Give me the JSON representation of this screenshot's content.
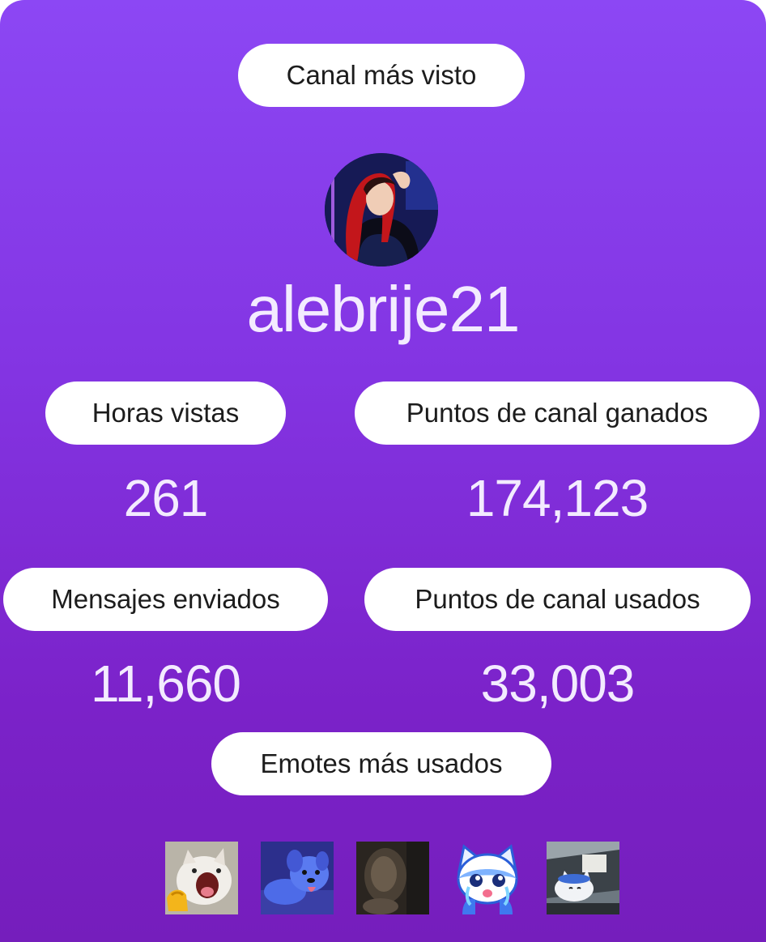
{
  "header": {
    "title": "Canal más visto"
  },
  "channel": {
    "name": "alebrije21",
    "avatar_icon": "streamer-avatar"
  },
  "stats": [
    {
      "label": "Horas vistas",
      "value": "261"
    },
    {
      "label": "Puntos de canal ganados",
      "value": "174,123"
    },
    {
      "label": "Mensajes enviados",
      "value": "11,660"
    },
    {
      "label": "Puntos de canal usados",
      "value": "33,003"
    }
  ],
  "emotes": {
    "title": "Emotes más usados",
    "items": [
      "screaming-cat-emote",
      "blue-dog-emote",
      "blurry-cat-emote",
      "crying-cat-emote",
      "cat-in-car-emote"
    ]
  },
  "colors": {
    "background_top": "#8c47f4",
    "background_bottom": "#751ebc",
    "pill": "#ffffff",
    "value_text": "#f3ebff"
  }
}
